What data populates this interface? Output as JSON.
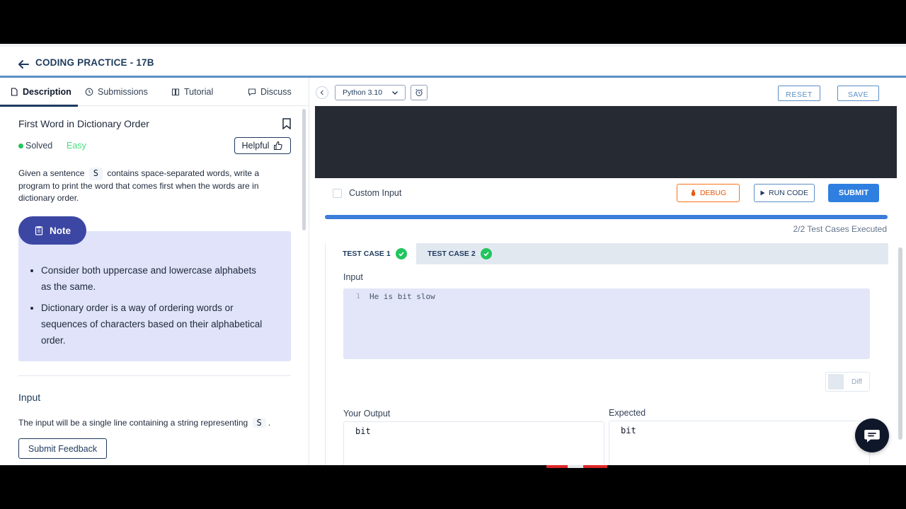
{
  "header": {
    "title": "CODING PRACTICE - 17B"
  },
  "left_tabs": [
    {
      "label": "Description",
      "icon": "document-icon",
      "active": true
    },
    {
      "label": "Submissions",
      "icon": "clock-icon"
    },
    {
      "label": "Tutorial",
      "icon": "book-icon"
    },
    {
      "label": "Discuss",
      "icon": "chat-icon"
    }
  ],
  "problem": {
    "title": "First Word in Dictionary Order",
    "status": "Solved",
    "difficulty": "Easy",
    "helpful_label": "Helpful",
    "desc_before": "Given a sentence",
    "desc_var": "S",
    "desc_after": "contains space-separated words, write a program to print the word that comes first when the words are in dictionary order.",
    "note_label": "Note",
    "notes": [
      "Consider both uppercase and lowercase alphabets as the same.",
      "Dictionary order is a way of ordering words or sequences of characters based on their alphabetical order."
    ],
    "input_heading": "Input",
    "input_desc": "The input will be a single line containing a string representing",
    "input_var": "S",
    "input_end": "."
  },
  "feedback_label": "Submit Feedback",
  "toolbar": {
    "language": "Python 3.10",
    "reset_label": "RESET",
    "save_label": "SAVE"
  },
  "actions": {
    "custom_input_label": "Custom Input",
    "debug_label": "DEBUG",
    "run_label": "RUN CODE",
    "submit_label": "SUBMIT"
  },
  "progress": {
    "fraction": 1.0,
    "text": "2/2 Test Cases Executed"
  },
  "test_cases": {
    "tabs": [
      {
        "label": "TEST CASE 1",
        "passed": true,
        "active": true
      },
      {
        "label": "TEST CASE 2",
        "passed": true
      }
    ],
    "input_label": "Input",
    "line_number": "1",
    "input_value": "He is bit slow",
    "diff_label": "Diff",
    "your_output_label": "Your Output",
    "expected_label": "Expected",
    "your_output": "bit",
    "expected": "bit"
  },
  "colors": {
    "accent": "#2f7fe0",
    "note_bg": "#e0e3f9",
    "note_pill": "#3b47a3",
    "success": "#22c55e",
    "debug": "#ea580c"
  }
}
